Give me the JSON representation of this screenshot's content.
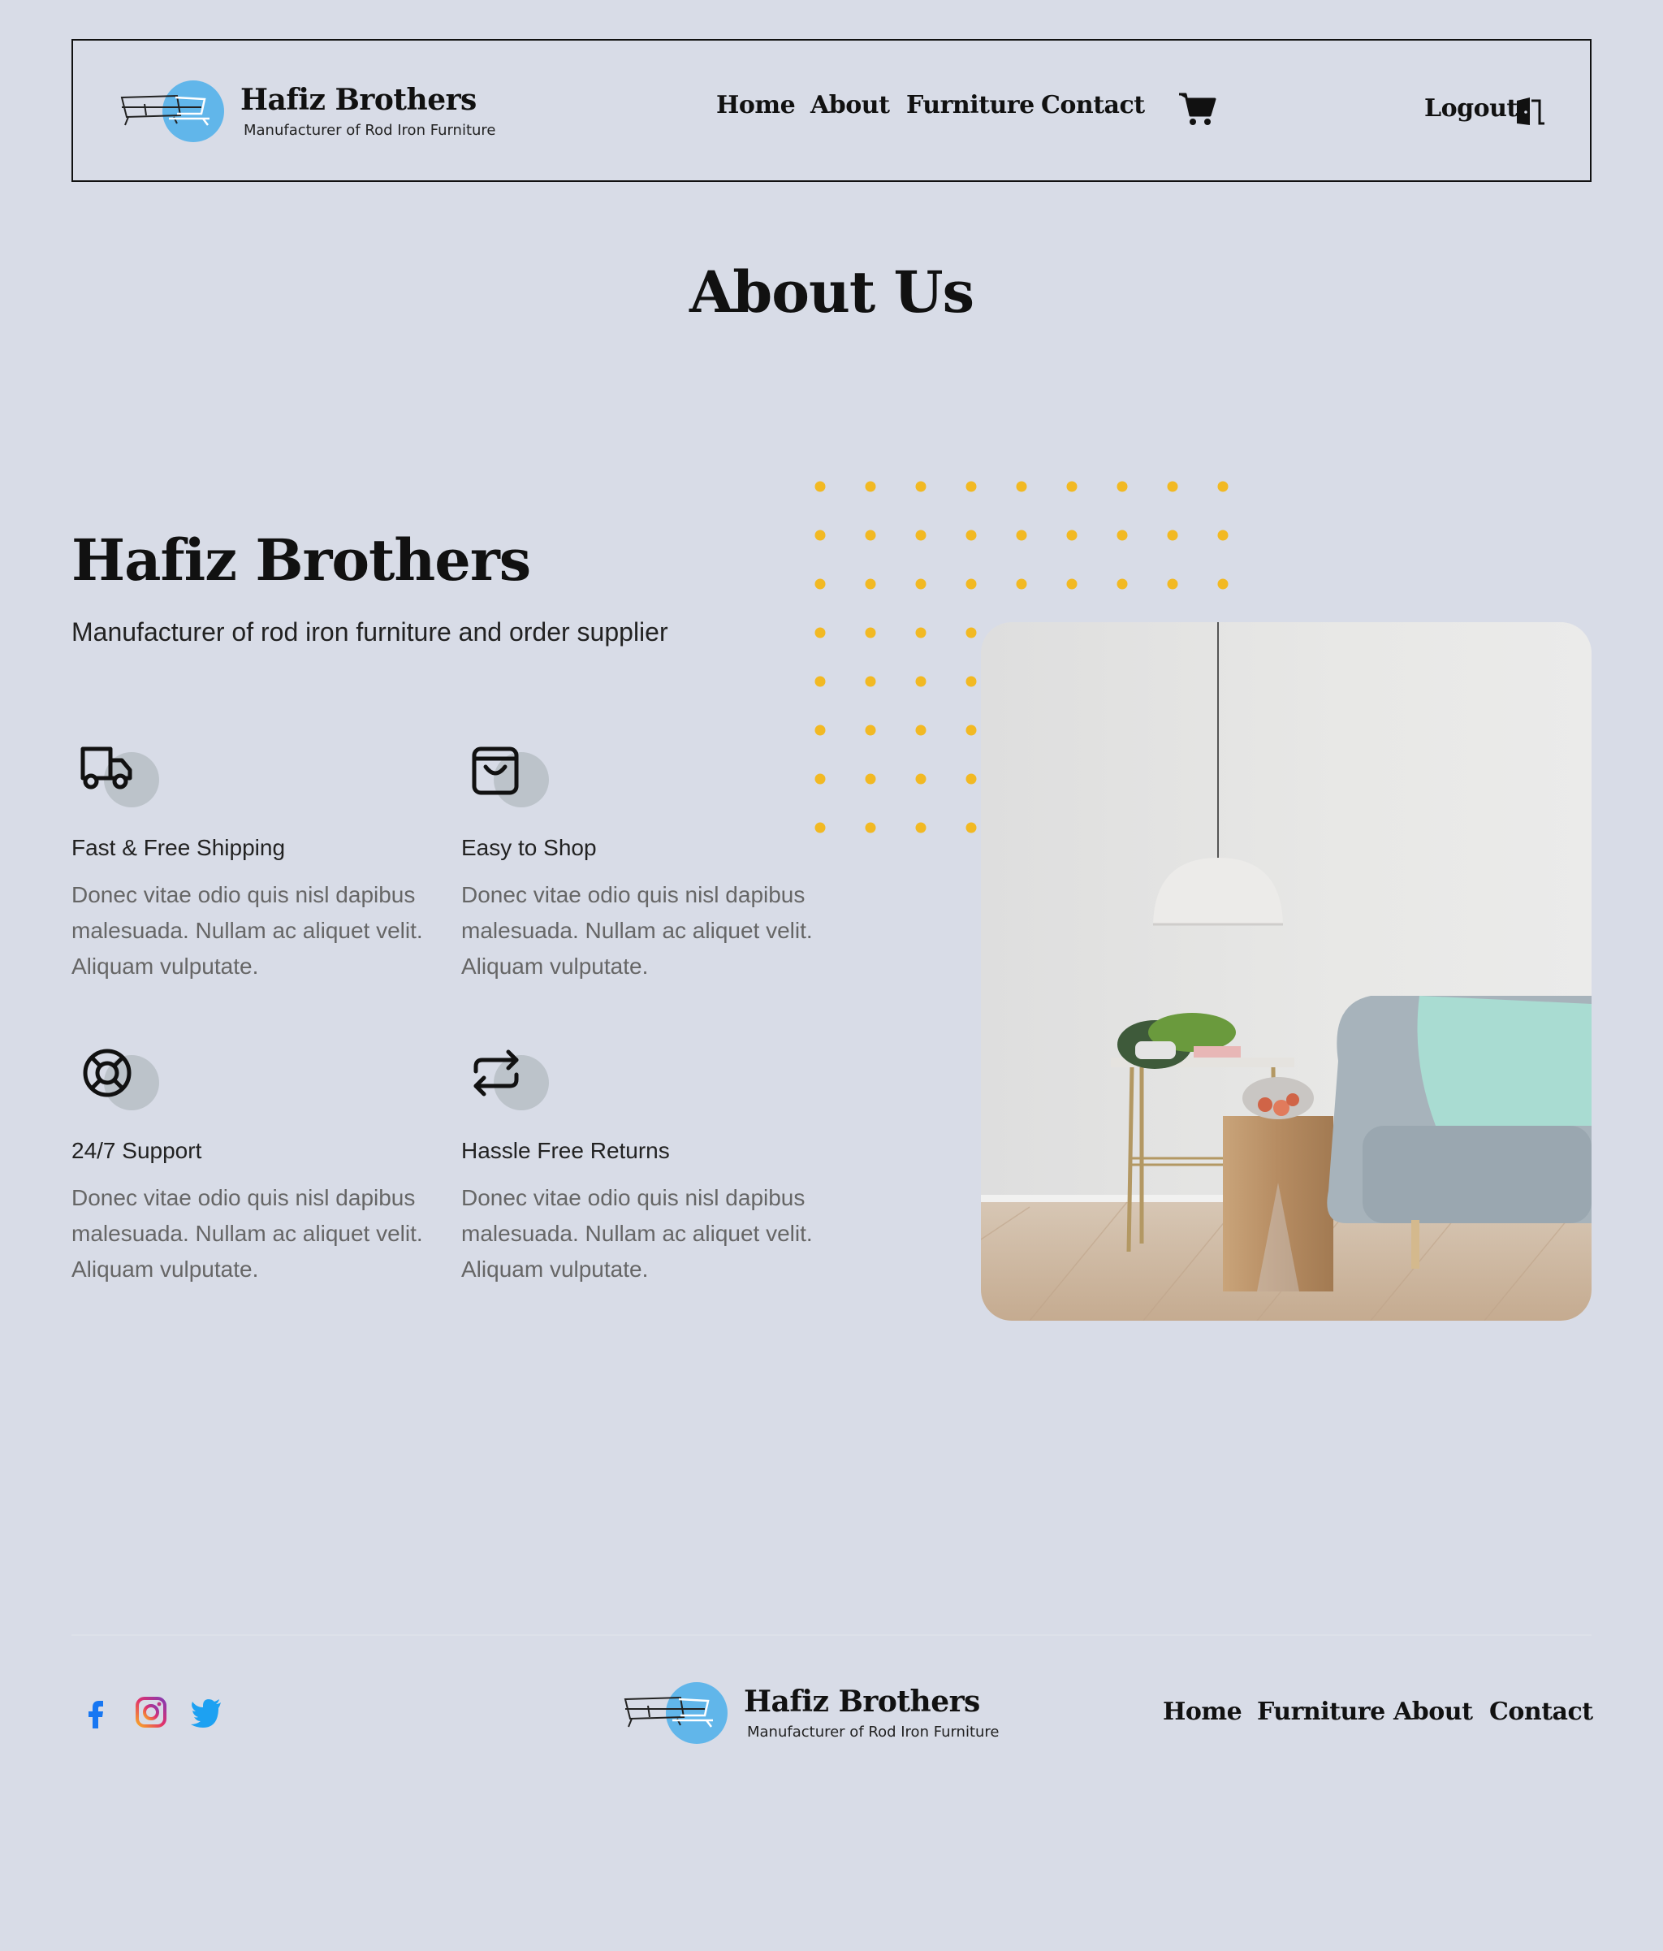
{
  "header": {
    "brand_name": "Hafiz Brothers",
    "brand_tagline": "Manufacturer of Rod Iron Furniture",
    "nav": [
      "Home",
      "About",
      "Furniture",
      "Contact"
    ],
    "cart_icon": "shopping-cart-icon",
    "logout_label": "Logout",
    "logout_icon": "door-exit-icon"
  },
  "page_title": "About Us",
  "hero": {
    "title": "Hafiz Brothers",
    "subtitle": "Manufacturer of rod iron furniture and order supplier"
  },
  "features": [
    {
      "icon": "truck-icon",
      "title": "Fast & Free Shipping",
      "text": "Donec vitae odio quis nisl dapibus malesuada. Nullam ac aliquet velit. Aliquam vulputate."
    },
    {
      "icon": "shopping-bag-icon",
      "title": "Easy to Shop",
      "text": "Donec vitae odio quis nisl dapibus malesuada. Nullam ac aliquet velit. Aliquam vulputate."
    },
    {
      "icon": "lifebuoy-icon",
      "title": "24/7 Support",
      "text": "Donec vitae odio quis nisl dapibus malesuada. Nullam ac aliquet velit. Aliquam vulputate."
    },
    {
      "icon": "repeat-arrows-icon",
      "title": "Hassle Free Returns",
      "text": "Donec vitae odio quis nisl dapibus malesuada. Nullam ac aliquet velit. Aliquam vulputate."
    }
  ],
  "image": {
    "alt": "living room with pendant lamp, side table and sofa"
  },
  "footer": {
    "social": [
      "facebook-icon",
      "instagram-icon",
      "twitter-icon"
    ],
    "brand_name": "Hafiz Brothers",
    "brand_tagline": "Manufacturer of Rod Iron Furniture",
    "nav": [
      "Home",
      "Furniture",
      "About",
      "Contact"
    ]
  },
  "colors": {
    "background": "#d8dce7",
    "accent_dot": "#f2b923",
    "logo_circle": "#61b6ea",
    "facebook": "#1877f2",
    "twitter": "#1da1f2"
  }
}
